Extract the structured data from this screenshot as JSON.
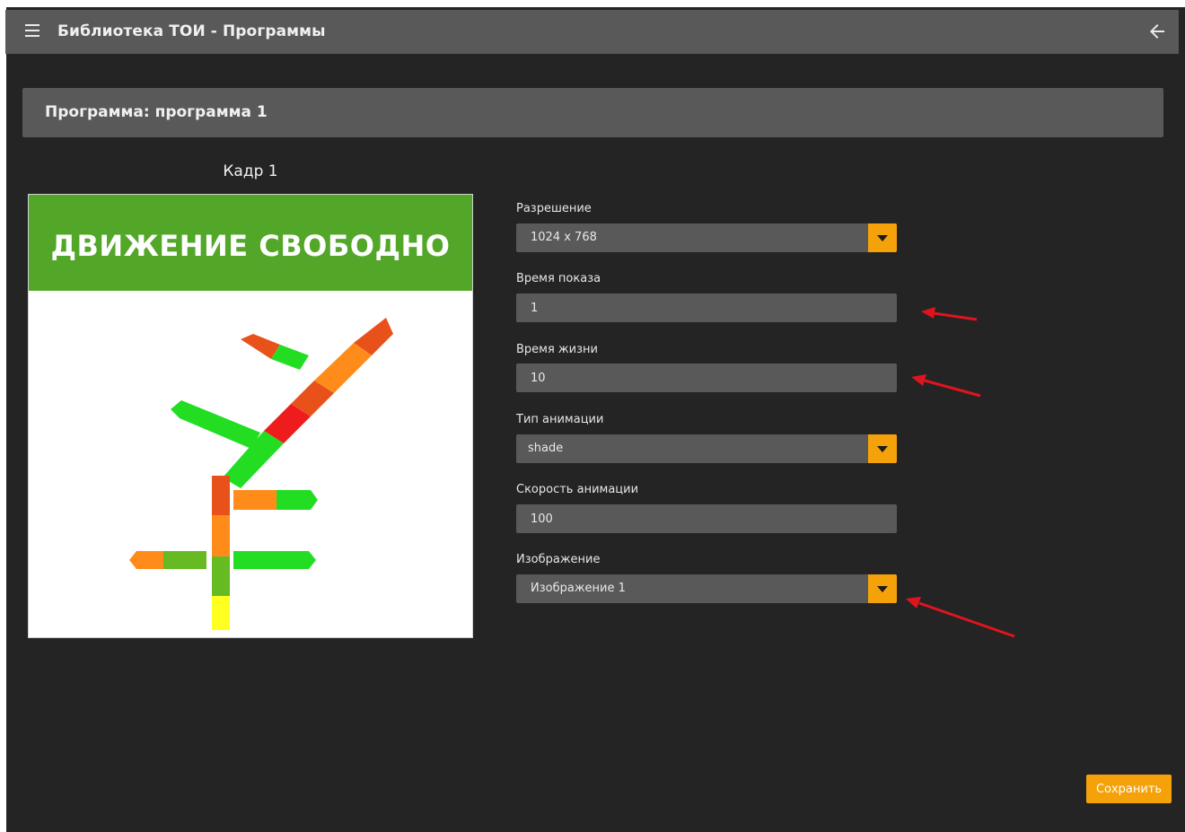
{
  "app": {
    "title": "Библиотека ТОИ - Программы",
    "menu_icon": "hamburger-menu-icon",
    "back_icon": "arrow-left-icon"
  },
  "program": {
    "header": "Программа: программа 1"
  },
  "frame": {
    "title": "Кадр 1",
    "banner_text": "ДВИЖЕНИЕ СВОБОДНО",
    "banner_color": "#52a728"
  },
  "form": {
    "resolution": {
      "label": "Разрешение",
      "value": "1024 x 768"
    },
    "display_time": {
      "label": "Время показа",
      "value": "1"
    },
    "lifetime": {
      "label": "Время жизни",
      "value": "10"
    },
    "animation_type": {
      "label": "Тип анимации",
      "value": "shade"
    },
    "animation_speed": {
      "label": "Скорость анимации",
      "value": "100"
    },
    "image": {
      "label": "Изображение",
      "value": "Изображение 1"
    }
  },
  "actions": {
    "save_label": "Сохранить"
  },
  "colors": {
    "accent": "#f5a20a",
    "panel": "#595959",
    "background": "#242424",
    "annotation_arrow": "#e0141e"
  }
}
